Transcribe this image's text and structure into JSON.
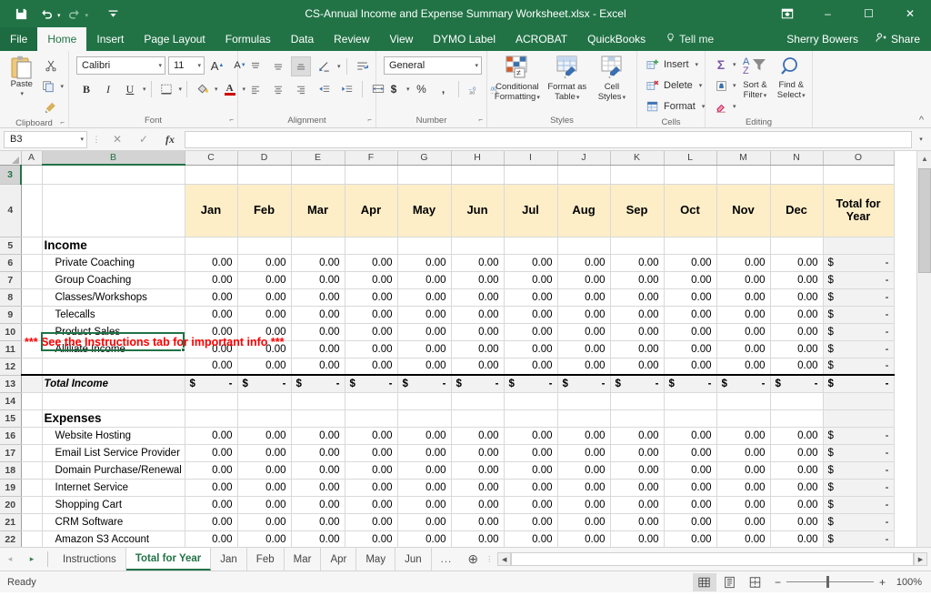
{
  "titlebar": {
    "save_icon": "save-icon",
    "undo_icon": "undo-icon",
    "redo_icon": "redo-icon",
    "customize_icon": "customize-qat-icon",
    "title": "CS-Annual Income and Expense Summary Worksheet.xlsx - Excel",
    "ribbon_display_icon": "ribbon-display-options-icon",
    "minimize": "–",
    "maximize": "☐",
    "close": "✕"
  },
  "ribbon_tabs": [
    {
      "label": "File"
    },
    {
      "label": "Home"
    },
    {
      "label": "Insert"
    },
    {
      "label": "Page Layout"
    },
    {
      "label": "Formulas"
    },
    {
      "label": "Data"
    },
    {
      "label": "Review"
    },
    {
      "label": "View"
    },
    {
      "label": "DYMO Label"
    },
    {
      "label": "ACROBAT"
    },
    {
      "label": "QuickBooks"
    }
  ],
  "tell_me": "Tell me",
  "user": "Sherry Bowers",
  "share": "Share",
  "ribbon": {
    "clipboard": {
      "label": "Clipboard",
      "paste": "Paste",
      "cut": "cut-icon",
      "copy": "copy-icon",
      "format_painter": "format-painter-icon"
    },
    "font": {
      "label": "Font",
      "font_name": "Calibri",
      "font_size": "11",
      "grow": "A",
      "shrink": "A",
      "bold": "B",
      "italic": "I",
      "underline": "U",
      "borders": "borders-icon",
      "fill": "fill-color-icon",
      "fontcolor": "A"
    },
    "alignment": {
      "label": "Alignment",
      "align_top": "align-top-icon",
      "align_middle": "align-middle-icon",
      "align_bottom": "align-bottom-icon",
      "orientation": "orientation-icon",
      "align_left": "align-left-icon",
      "align_center": "align-center-icon",
      "align_right": "align-right-icon",
      "decrease_indent": "decrease-indent-icon",
      "increase_indent": "increase-indent-icon",
      "wrap_text": "wrap-text-icon",
      "merge_center": "merge-and-center-icon"
    },
    "number": {
      "label": "Number",
      "format": "General",
      "accounting": "$",
      "percent": "%",
      "comma": ",",
      "increase_decimal": "increase-decimal-icon",
      "decrease_decimal": "decrease-decimal-icon"
    },
    "styles": {
      "label": "Styles",
      "conditional_formatting_l1": "Conditional",
      "conditional_formatting_l2": "Formatting",
      "format_as_table_l1": "Format as",
      "format_as_table_l2": "Table",
      "cell_styles_l1": "Cell",
      "cell_styles_l2": "Styles"
    },
    "cells": {
      "label": "Cells",
      "insert": "Insert",
      "delete": "Delete",
      "format": "Format"
    },
    "editing": {
      "label": "Editing",
      "autosum": "Σ",
      "fill": "fill-down-icon",
      "clear": "clear-icon",
      "sort_filter_l1": "Sort &",
      "sort_filter_l2": "Filter",
      "find_select_l1": "Find &",
      "find_select_l2": "Select"
    },
    "collapse_icon": "collapse-ribbon-icon"
  },
  "formula_bar": {
    "name_box": "B3",
    "cancel_icon": "cancel-icon",
    "enter_icon": "confirm-icon",
    "fx_icon": "fx",
    "formula_value": "",
    "expand_icon": "expand-formula-bar-icon"
  },
  "grid": {
    "columns": [
      "A",
      "B",
      "C",
      "D",
      "E",
      "F",
      "G",
      "H",
      "I",
      "J",
      "K",
      "L",
      "M",
      "N",
      "O"
    ],
    "selected_column": "B",
    "selected_row": "3",
    "row_numbers": [
      "3",
      "4",
      "5",
      "6",
      "7",
      "8",
      "9",
      "10",
      "11",
      "12",
      "13",
      "14",
      "15",
      "16",
      "17",
      "18",
      "19",
      "20",
      "21",
      "22"
    ],
    "note_text": "*** See the Instructions tab for important info ***",
    "note_prefix": "***",
    "month_headers": [
      "Jan",
      "Feb",
      "Mar",
      "Apr",
      "May",
      "Jun",
      "Jul",
      "Aug",
      "Sep",
      "Oct",
      "Nov",
      "Dec"
    ],
    "year_header_l1": "Total for",
    "year_header_l2": "Year",
    "income_section": "Income",
    "expenses_section": "Expenses",
    "total_income_label": "Total Income",
    "zero": "0.00",
    "dollar": "$",
    "dash": "-",
    "income_rows": [
      "Private Coaching",
      "Group Coaching",
      "Classes/Workshops",
      "Telecalls",
      "Product Sales",
      "Alliliate Income",
      ""
    ],
    "expense_rows": [
      "Website Hosting",
      "Email List Service Provider",
      "Domain Purchase/Renewal",
      "Internet Service",
      "Shopping Cart",
      "CRM Software",
      "Amazon S3 Account"
    ]
  },
  "sheet_tabs": {
    "first_arrow": "◂",
    "last_arrow": "▸",
    "tabs": [
      {
        "label": "Instructions",
        "active": false
      },
      {
        "label": "Total for Year",
        "active": true
      },
      {
        "label": "Jan",
        "active": false
      },
      {
        "label": "Feb",
        "active": false
      },
      {
        "label": "Mar",
        "active": false
      },
      {
        "label": "Apr",
        "active": false
      },
      {
        "label": "May",
        "active": false
      },
      {
        "label": "Jun",
        "active": false
      },
      {
        "label": "...",
        "active": false
      }
    ],
    "add_sheet": "⊕"
  },
  "status_bar": {
    "status": "Ready",
    "normal_view": "normal-view-icon",
    "page_layout_view": "page-layout-view-icon",
    "page_break_view": "page-break-preview-icon",
    "zoom_out": "−",
    "zoom_in": "+",
    "zoom_level": "100%"
  },
  "colors": {
    "excel_green": "#217346",
    "header_fill": "#fdeec8",
    "total_fill": "#f2f2f2",
    "note_red": "#ff0000"
  }
}
